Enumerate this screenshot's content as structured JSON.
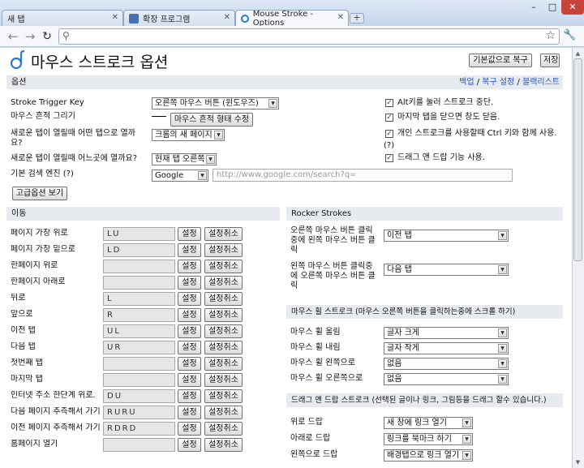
{
  "browser": {
    "tabs": [
      {
        "label": "새 탭"
      },
      {
        "label": "확장 프로그램"
      },
      {
        "label": "Mouse Stroke - Options"
      }
    ],
    "new_tab": "+",
    "window_buttons": [
      "–",
      "□",
      "✕"
    ],
    "address": "",
    "nav_icons": [
      "back-icon",
      "forward-icon",
      "reload-icon"
    ],
    "star": "☆",
    "wrench": "🔧"
  },
  "header": {
    "title": "마우스 스트로크 옵션",
    "reset_label": "기본값으로 복구",
    "save_label": "저장"
  },
  "options": {
    "section_label": "옵션",
    "links": [
      "백업",
      "복구 설정",
      "블랙리스트"
    ],
    "link_sep": " / ",
    "left": [
      {
        "label": "Stroke Trigger Key",
        "select": "오른쪽 마우스 버튼 (윈도우즈)"
      },
      {
        "label": "마우스 흔적 그리기",
        "button": "마우스 흔적 형태 수정"
      },
      {
        "label": "새로운 탭이 열릴때 어떤 탭으로 열까요?",
        "select": "크롬의 새 페이지"
      },
      {
        "label": "새로운 탭이 열릴때 어느곳에 열까요?",
        "select": "현재 탭 오른쪽"
      },
      {
        "label": "기본 검색 엔진 (?)",
        "select": "Google",
        "url": "http://www.google.com/search?q="
      }
    ],
    "advanced_label": "고급옵션 보기",
    "checks": [
      {
        "label": "Alt키를 눌러 스트로크 중단.",
        "checked": true
      },
      {
        "label": "마지막 탭을 닫으면 창도 닫음.",
        "checked": true
      },
      {
        "label": "개인 스트로크를 사용할때 Ctrl 키와 함께 사용.",
        "checked": true,
        "note": "(?)"
      },
      {
        "label": "드래그 앤 드랍 기능 사용.",
        "checked": true
      }
    ]
  },
  "move": {
    "section_label": "이동",
    "set_label": "설정",
    "unset_label": "설정취소",
    "rows": [
      {
        "label": "페이지 가장 위로",
        "value": "LU"
      },
      {
        "label": "페이지 가장 밑으로",
        "value": "LD"
      },
      {
        "label": "한페이지 위로",
        "value": ""
      },
      {
        "label": "한페이지 아래로",
        "value": ""
      },
      {
        "label": "뒤로",
        "value": "L"
      },
      {
        "label": "앞으로",
        "value": "R"
      },
      {
        "label": "이전 탭",
        "value": "UL"
      },
      {
        "label": "다음 탭",
        "value": "UR"
      },
      {
        "label": "첫번째 탭",
        "value": ""
      },
      {
        "label": "마지막 탭",
        "value": ""
      },
      {
        "label": "인터넷 주소 한단계 위로.",
        "value": "DU"
      },
      {
        "label": "다음 페이지 추측해서 가기",
        "value": "RURU"
      },
      {
        "label": "이전 페이지 추측해서 가기",
        "value": "RDRD"
      },
      {
        "label": "홈페이지 열기",
        "value": ""
      }
    ]
  },
  "rocker": {
    "section_label": "Rocker Strokes",
    "rows": [
      {
        "label": "오른쪽 마우스 버튼 클릭중에 왼쪽 마우스 버튼 클릭",
        "select": "이전 탭"
      },
      {
        "label": "왼쪽 마우스 버튼 클릭중에 오른쪽 마우스 버튼 클릭",
        "select": "다음 탭"
      }
    ]
  },
  "wheel": {
    "section_label": "마우스 휠 스트로크 (마우스 오른쪽 버튼을 클릭하는중에 스크롤 하기)",
    "rows": [
      {
        "label": "마우스 휠 올림",
        "select": "글자 크게"
      },
      {
        "label": "마우스 휠 내림",
        "select": "글자 작게"
      },
      {
        "label": "마우스 휠 왼쪽으로",
        "select": "없음"
      },
      {
        "label": "마우스 휠 오른쪽으로",
        "select": "없음"
      }
    ]
  },
  "drag": {
    "section_label": "드래그 앤 드랍 스트로크 (선택된 글이나 링크, 그림등을 드래그 할수 있습니다.)",
    "rows": [
      {
        "label": "위로 드랍",
        "select": "새 창에 링크 열기"
      },
      {
        "label": "아래로 드랍",
        "select": "링크를 북마크 하기"
      },
      {
        "label": "왼쪽으로 드랍",
        "select": "배경탭으로 링크 열기"
      }
    ]
  }
}
